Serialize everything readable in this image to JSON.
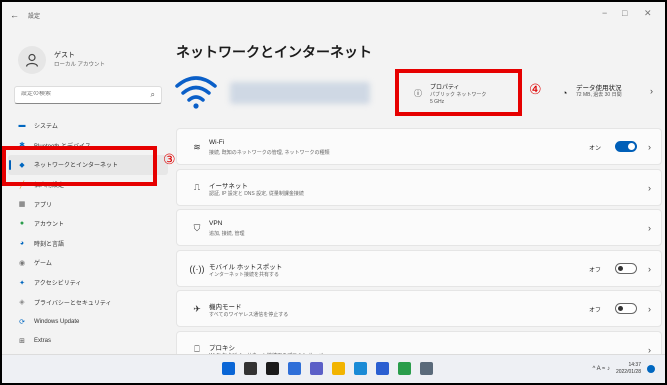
{
  "window": {
    "back_glyph": "←",
    "title": "設定",
    "min": "−",
    "max": "□",
    "close": "✕"
  },
  "user": {
    "name": "ゲスト",
    "account": "ローカル アカウント"
  },
  "search": {
    "placeholder": "設定の検索"
  },
  "sidebar": {
    "items": [
      {
        "label": "システム",
        "icon": "display-icon",
        "color": "#0067c0"
      },
      {
        "label": "Bluetooth とデバイス",
        "icon": "bluetooth-icon",
        "color": "#0067c0"
      },
      {
        "label": "ネットワークとインターネット",
        "icon": "network-icon",
        "color": "#0067c0",
        "active": true
      },
      {
        "label": "個人用設定",
        "icon": "brush-icon",
        "color": "#e08a1e"
      },
      {
        "label": "アプリ",
        "icon": "apps-icon",
        "color": "#555"
      },
      {
        "label": "アカウント",
        "icon": "person-icon",
        "color": "#2a9d4b"
      },
      {
        "label": "時刻と言語",
        "icon": "globe-clock-icon",
        "color": "#0067c0"
      },
      {
        "label": "ゲーム",
        "icon": "gamepad-icon",
        "color": "#777"
      },
      {
        "label": "アクセシビリティ",
        "icon": "accessibility-icon",
        "color": "#0067c0"
      },
      {
        "label": "プライバシーとセキュリティ",
        "icon": "shield-icon",
        "color": "#888"
      },
      {
        "label": "Windows Update",
        "icon": "update-icon",
        "color": "#0067c0"
      },
      {
        "label": "Extras",
        "icon": "extras-icon",
        "color": "#555"
      }
    ]
  },
  "main": {
    "title": "ネットワークとインターネット",
    "properties": {
      "label": "プロパティ",
      "sub1": "パブリック ネットワーク",
      "sub2": "5 GHz"
    },
    "data_usage": {
      "label": "データ使用状況",
      "sub": "72 MB, 過去 30 日間"
    },
    "cards": [
      {
        "title": "Wi-Fi",
        "sub": "接続, 既知のネットワークの管理, ネットワークの種類",
        "state": "オン",
        "toggle": "on",
        "icon": "wifi-icon"
      },
      {
        "title": "イーサネット",
        "sub": "認証, IP 設定と DNS 設定, 従量制課金接続",
        "state": "",
        "toggle": "none",
        "icon": "ethernet-icon"
      },
      {
        "title": "VPN",
        "sub": "追加, 接続, 管理",
        "state": "",
        "toggle": "none",
        "icon": "vpn-shield-icon"
      },
      {
        "title": "モバイル ホットスポット",
        "sub": "インターネット接続を共有する",
        "state": "オフ",
        "toggle": "off",
        "icon": "hotspot-icon"
      },
      {
        "title": "機内モード",
        "sub": "すべてのワイヤレス通信を停止する",
        "state": "オフ",
        "toggle": "off",
        "icon": "airplane-icon"
      },
      {
        "title": "プロキシ",
        "sub": "Wi-Fi およびイーサネット接続用のプロキシ サーバー",
        "state": "",
        "toggle": "none",
        "icon": "proxy-icon"
      }
    ]
  },
  "annotations": {
    "marker3": "③",
    "marker4": "④"
  },
  "taskbar": {
    "icons": [
      {
        "name": "start-icon",
        "color": "#0a66d6"
      },
      {
        "name": "search-icon",
        "color": "#333"
      },
      {
        "name": "task-view-icon",
        "color": "#1b1b1b"
      },
      {
        "name": "widgets-icon",
        "color": "#2f6fd8"
      },
      {
        "name": "chat-icon",
        "color": "#5b5fc7"
      },
      {
        "name": "explorer-icon",
        "color": "#f2b400"
      },
      {
        "name": "edge-icon",
        "color": "#1a8bd6"
      },
      {
        "name": "store-icon",
        "color": "#2b5fd1"
      },
      {
        "name": "chrome-icon",
        "color": "#2a9d4b"
      },
      {
        "name": "settings-icon",
        "color": "#5a6a7a"
      }
    ],
    "tray_symbols": "^ A ≈ ♪",
    "time": "14:37",
    "date": "2022/01/28"
  }
}
